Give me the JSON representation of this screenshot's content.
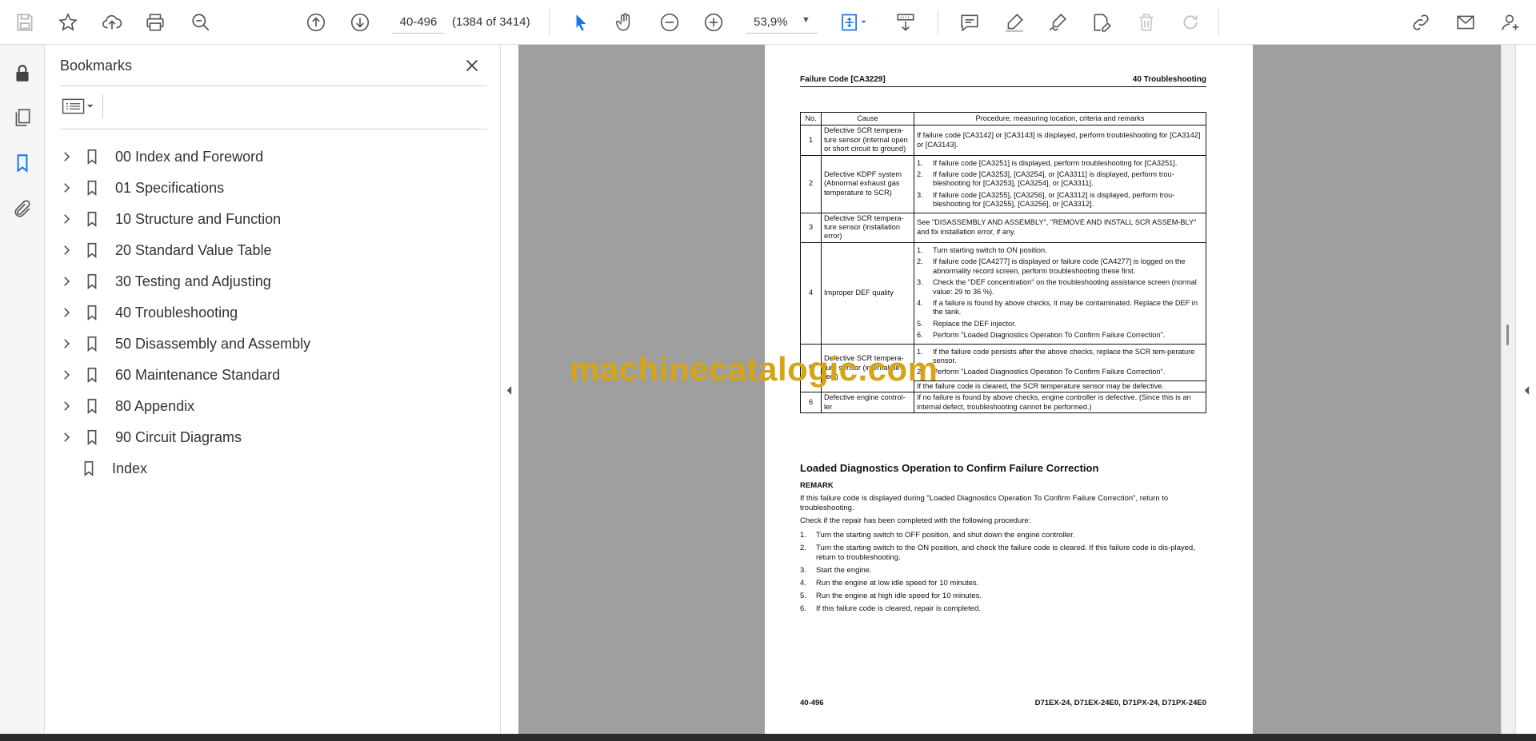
{
  "toolbar": {
    "page_input_value": "40-496",
    "page_count": "(1384 of 3414)",
    "zoom_value": "53,9%",
    "icons": [
      "save-icon",
      "star-icon",
      "upload-icon",
      "print-icon",
      "zoom-search-icon",
      "prev-page-icon",
      "next-page-icon",
      "zoom-out-icon",
      "zoom-in-icon",
      "select-cursor-icon",
      "hand-icon",
      "fit-page-icon",
      "scroll-mode-icon",
      "comment-icon",
      "highlight-icon",
      "sign-icon",
      "edit-pdf-icon",
      "delete-icon",
      "redo-icon",
      "share-link-icon",
      "email-icon",
      "account-icon"
    ],
    "accent_color": "#1473e6"
  },
  "left_rail": {
    "icons": [
      "lock-icon",
      "pages-icon",
      "bookmark-icon",
      "attachment-icon"
    ]
  },
  "bookmarks": {
    "title": "Bookmarks",
    "items": [
      {
        "label": "00 Index and Foreword",
        "expandable": true
      },
      {
        "label": "01 Specifications",
        "expandable": true
      },
      {
        "label": "10 Structure and Function",
        "expandable": true
      },
      {
        "label": "20 Standard Value Table",
        "expandable": true
      },
      {
        "label": "30 Testing and Adjusting",
        "expandable": true
      },
      {
        "label": "40 Troubleshooting",
        "expandable": true
      },
      {
        "label": "50 Disassembly and Assembly",
        "expandable": true
      },
      {
        "label": "60 Maintenance Standard",
        "expandable": true
      },
      {
        "label": "80 Appendix",
        "expandable": true
      },
      {
        "label": "90 Circuit Diagrams",
        "expandable": true
      },
      {
        "label": "Index",
        "expandable": false
      }
    ]
  },
  "page": {
    "header_left": "Failure Code [CA3229]",
    "header_right": "40 Troubleshooting",
    "table": {
      "headers": [
        "No.",
        "Cause",
        "Procedure, measuring location, criteria and remarks"
      ],
      "rows": [
        {
          "no": "1",
          "cause": "Defective SCR tempera-ture sensor (internal open or short circuit to ground)",
          "text": "If failure code [CA3142] or [CA3143] is displayed, perform troubleshooting for [CA3142] or [CA3143]."
        },
        {
          "no": "2",
          "cause": "Defective KDPF system (Abnormal exhaust gas temperature to SCR)",
          "steps": [
            {
              "n": "1.",
              "t": "If failure code [CA3251] is displayed, perform troubleshooting for [CA3251]."
            },
            {
              "n": "2.",
              "t": "If failure code [CA3253], [CA3254], or [CA3311] is displayed, perform trou-bleshooting for [CA3253], [CA3254], or [CA3311]."
            },
            {
              "n": "3.",
              "t": "If failure code [CA3255], [CA3256], or [CA3312] is displayed, perform trou-bleshooting for [CA3255], [CA3256], or [CA3312]."
            }
          ]
        },
        {
          "no": "3",
          "cause": "Defective SCR tempera-ture sensor (installation error)",
          "text": "See \"DISASSEMBLY AND ASSEMBLY\", \"REMOVE AND INSTALL SCR ASSEM-BLY\" and fix installation error, if any."
        },
        {
          "no": "4",
          "cause": "Improper DEF quality",
          "steps": [
            {
              "n": "1.",
              "t": "Turn starting switch to ON position."
            },
            {
              "n": "2.",
              "t": "If failure code [CA4277] is displayed or failure code [CA4277] is logged on the abnormality record screen, perform troubleshooting these first."
            },
            {
              "n": "3.",
              "t": "Check the \"DEF concentration\" on the troubleshooting assistance screen (normal value: 29 to 36 %)."
            },
            {
              "n": "4.",
              "t": "If a failure is found by above checks, it may be contaminated. Replace the DEF in the tank."
            },
            {
              "n": "5.",
              "t": "Replace the DEF injector."
            },
            {
              "n": "6.",
              "t": "Perform \"Loaded Diagnostics Operation To Confirm Failure Correction\"."
            }
          ]
        },
        {
          "no": "5",
          "cause": "Defective SCR tempera-ture sensor (internal de-fect)",
          "steps": [
            {
              "n": "1.",
              "t": "If the failure code persists after the above checks, replace the SCR tem-perature sensor."
            },
            {
              "n": "2.",
              "t": "Perform \"Loaded Diagnostics Operation To Confirm Failure Correction\"."
            }
          ],
          "extra": "If the failure code is cleared, the SCR temperature sensor may be defective."
        },
        {
          "no": "6",
          "cause": "Defective engine control-ler",
          "text": "If no failure is found by above checks, engine controller is defective. (Since this is an internal defect, troubleshooting cannot be performed.)"
        }
      ]
    },
    "section_title": "Loaded Diagnostics Operation to Confirm Failure Correction",
    "remark_label": "REMARK",
    "remark_text": "If this failure code is displayed during \"Loaded Diagnostics Operation To Confirm Failure Correction\", return to troubleshooting.",
    "check_text": "Check if the repair has been completed with the following procedure:",
    "procedure": [
      {
        "n": "1.",
        "t": "Turn the starting switch to OFF position, and shut down the engine controller."
      },
      {
        "n": "2.",
        "t": "Turn the starting switch to the ON position, and check the failure code is cleared. If this failure code is dis-played, return to troubleshooting."
      },
      {
        "n": "3.",
        "t": "Start the engine."
      },
      {
        "n": "4.",
        "t": "Run the engine at low idle speed for 10 minutes."
      },
      {
        "n": "5.",
        "t": "Run the engine at high idle speed for 10 minutes."
      },
      {
        "n": "6.",
        "t": "If this failure code is cleared, repair is completed."
      }
    ],
    "footer_left": "40-496",
    "footer_right": "D71EX-24, D71EX-24E0, D71PX-24, D71PX-24E0"
  },
  "watermark": "machinecatalogic.com"
}
